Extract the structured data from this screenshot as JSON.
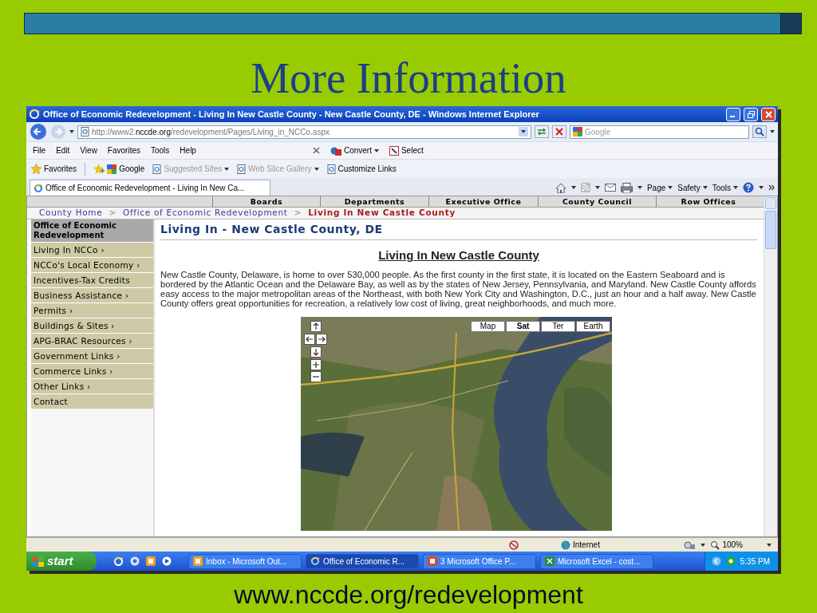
{
  "slide": {
    "title": "More Information",
    "footer": "www.nccde.org/redevelopment"
  },
  "browser": {
    "title": "Office of Economic Redevelopment - Living In New Castle County - New Castle County, DE - Windows Internet Explorer",
    "address": "http://www2.nccde.org/redevelopment/Pages/Living_in_NCCo.aspx",
    "search_placeholder": "Google",
    "menu": [
      "File",
      "Edit",
      "View",
      "Favorites",
      "Tools",
      "Help"
    ],
    "toolbar": [
      "Convert",
      "Select"
    ],
    "favorites": [
      {
        "label": "Favorites",
        "disabled": false
      },
      {
        "label": "Google",
        "disabled": false
      },
      {
        "label": "Suggested Sites",
        "disabled": true
      },
      {
        "label": "Web Slice Gallery",
        "disabled": true
      },
      {
        "label": "Customize Links",
        "disabled": false
      }
    ],
    "tab": "Office of Economic Redevelopment - Living In New Ca...",
    "command_bar": [
      "Page",
      "Safety",
      "Tools"
    ],
    "status": {
      "zone": "Internet",
      "zoom": "100%"
    }
  },
  "page": {
    "topnav": [
      "Boards",
      "Departments",
      "Executive Office",
      "County Council",
      "Row Offices"
    ],
    "breadcrumb": [
      {
        "kind": "link",
        "label": "County Home"
      },
      {
        "kind": "sep",
        "label": ">"
      },
      {
        "kind": "link",
        "label": "Office of Economic Redevelopment"
      },
      {
        "kind": "sep",
        "label": ">"
      },
      {
        "kind": "current",
        "label": "Living In New Castle County"
      }
    ],
    "sidebar": {
      "heading": "Office of Economic Redevelopment",
      "items": [
        "Living In NCCo ›",
        "NCCo's Local Economy ›",
        "Incentives-Tax Credits",
        "Business Assistance ›",
        "Permits ›",
        "Buildings & Sites ›",
        "APG-BRAC Resources ›",
        "Government Links ›",
        "Commerce Links ›",
        "Other Links ›",
        "Contact"
      ]
    },
    "heading": "Living In - New Castle County, DE",
    "subheading": "Living In New Castle County",
    "paragraph": "New Castle County, Delaware, is home to over 530,000 people. As the first county in the first state, it is located on the Eastern Seaboard and is bordered by the Atlantic Ocean and the Delaware Bay, as well as by the states of New Jersey, Pennsylvania, and Maryland. New Castle County affords easy access to the major metropolitan areas of the Northeast, with both New York City and Washington, D.C., just an hour and a half away. New Castle County offers great opportunities for recreation, a relatively low cost of living, great neighborhoods, and much more.",
    "map": {
      "kind": "picture",
      "types": [
        {
          "label": "Map",
          "selected": false
        },
        {
          "label": "Sat",
          "selected": true
        },
        {
          "label": "Ter",
          "selected": false
        },
        {
          "label": "Earth",
          "selected": false
        }
      ]
    }
  },
  "taskbar": {
    "start": "start",
    "items": [
      {
        "label": "Inbox - Microsoft Out...",
        "selected": false
      },
      {
        "label": "Office of Economic R...",
        "selected": true
      },
      {
        "label": "3 Microsoft Office P...",
        "selected": false
      },
      {
        "label": "Microsoft Excel - cost...",
        "selected": false
      }
    ],
    "clock": "5:35 PM"
  }
}
